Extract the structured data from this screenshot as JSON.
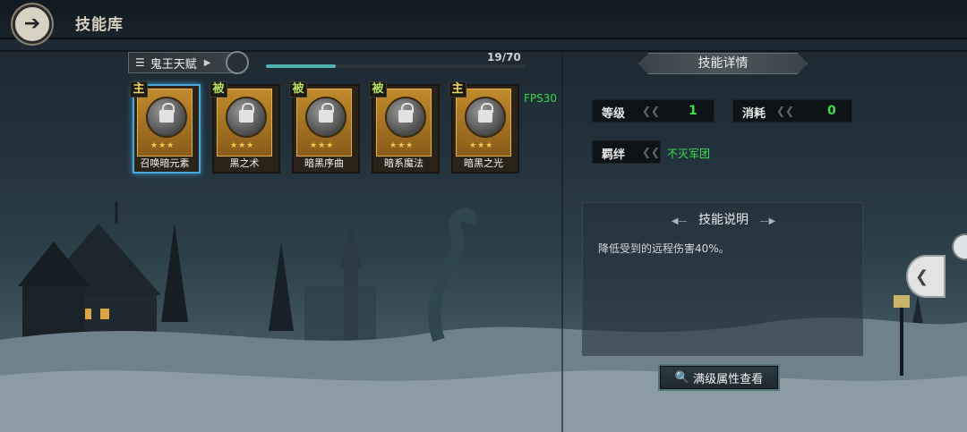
{
  "header": {
    "title": "技能库",
    "back_icon": "arrow-left-icon"
  },
  "category": {
    "label": "鬼王天赋",
    "progress_text": "19/70",
    "progress_fraction": 0.27
  },
  "fps": "FPS30",
  "skills": [
    {
      "tag": "主",
      "name": "召唤暗元素",
      "stars": "★★★",
      "type": "active",
      "selected": true
    },
    {
      "tag": "被",
      "name": "黑之术",
      "stars": "★★★",
      "type": "passive",
      "selected": false
    },
    {
      "tag": "被",
      "name": "暗黑序曲",
      "stars": "★★★",
      "type": "passive",
      "selected": false
    },
    {
      "tag": "被",
      "name": "暗系魔法",
      "stars": "★★★",
      "type": "passive",
      "selected": false
    },
    {
      "tag": "主",
      "name": "暗黑之光",
      "stars": "★★★",
      "type": "active",
      "selected": false
    }
  ],
  "detail": {
    "header": "技能详情",
    "level_label": "等级",
    "level_value": "1",
    "cost_label": "消耗",
    "cost_value": "0",
    "bond_label": "羁绊",
    "bond_value": "不灭军团",
    "desc_title": "技能说明",
    "desc_text": "降低受到的远程伤害40%。",
    "view_button": "满级属性查看"
  },
  "colors": {
    "accent_green": "#3ee04e",
    "selection_blue": "#4aa8d8",
    "card_gold": "#c08a2c"
  }
}
